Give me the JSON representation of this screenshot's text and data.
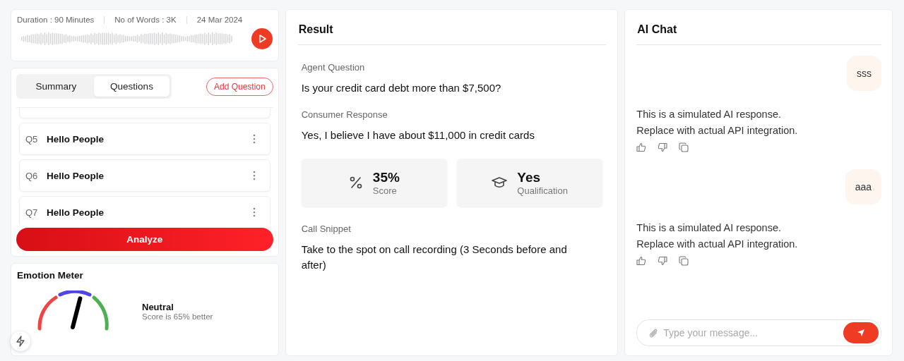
{
  "recording": {
    "meta": [
      "Duration : 90 Minutes",
      "No of Words : 3K",
      "24 Mar 2024"
    ]
  },
  "tabs": [
    {
      "label": "Summary",
      "selected": false
    },
    {
      "label": "Questions",
      "selected": true
    }
  ],
  "add_question": "Add Question",
  "questions": [
    {
      "number": "Q5",
      "text": "Hello People"
    },
    {
      "number": "Q6",
      "text": "Hello People"
    },
    {
      "number": "Q7",
      "text": "Hello People"
    }
  ],
  "analyze": "Analyze",
  "emotion_meter": {
    "title": "Emotion Meter",
    "label": "Neutral",
    "caption": "Score is 65% better"
  },
  "result": {
    "title": "Result",
    "sections_top": [
      {
        "label": "Agent Question",
        "value": "Is your credit card debt more than $7,500?"
      },
      {
        "label": "Consumer Response",
        "value": "Yes, I believe I have about $11,000 in credit cards"
      }
    ],
    "stats": [
      {
        "kind": "percent",
        "value": "35%",
        "label": "Score"
      },
      {
        "kind": "graduation",
        "value": "Yes",
        "label": "Qualification"
      }
    ],
    "snippet": {
      "label": "Call Snippet",
      "value": "Take to the spot on call recording (3 Seconds before and after)"
    }
  },
  "chat": {
    "title": "AI Chat",
    "messages": [
      {
        "kind": "user",
        "lines": [
          "sss"
        ]
      },
      {
        "kind": "ai",
        "lines": [
          "This is a simulated AI response.",
          "Replace with actual API integration."
        ]
      },
      {
        "kind": "user",
        "lines": [
          "aaa"
        ]
      },
      {
        "kind": "ai",
        "lines": [
          "This is a simulated AI response.",
          "Replace with actual API integration."
        ]
      }
    ],
    "placeholder": "Type your message..."
  }
}
